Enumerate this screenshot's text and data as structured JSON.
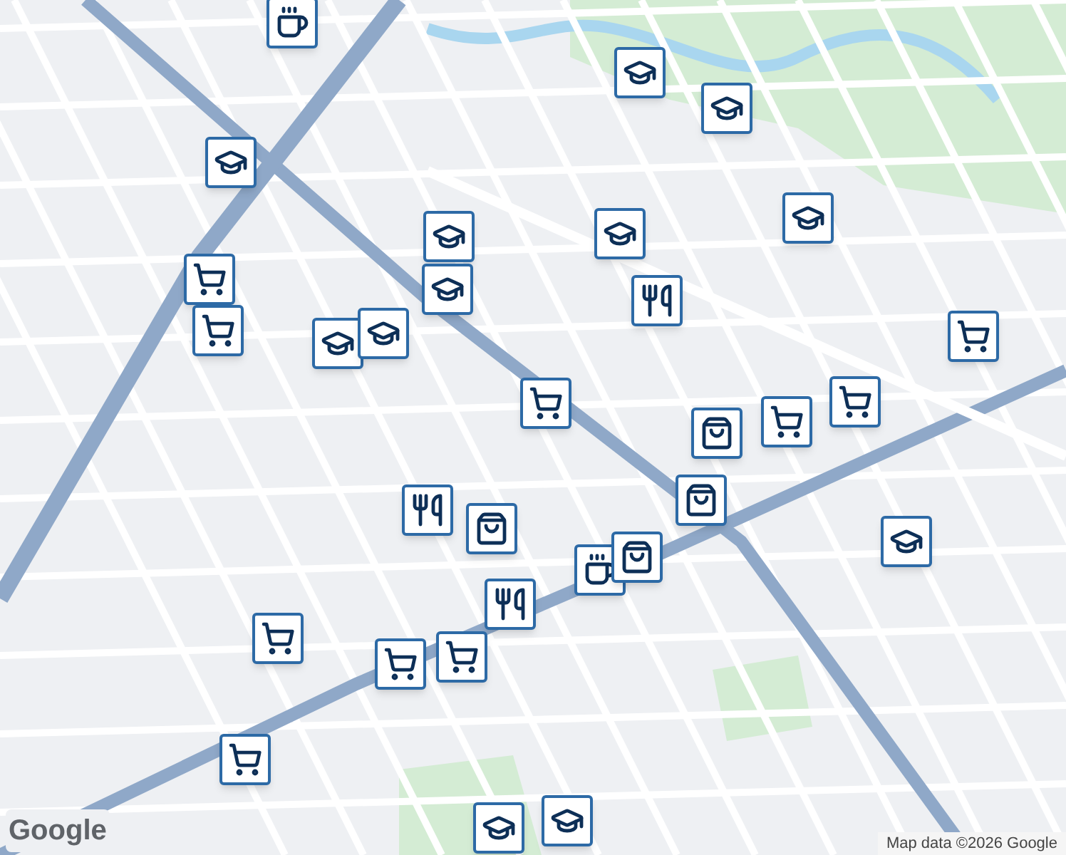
{
  "map": {
    "markers": [
      {
        "kind": "coffee"
      },
      {
        "kind": "school"
      },
      {
        "kind": "grocery"
      },
      {
        "kind": "grocery"
      },
      {
        "kind": "school"
      },
      {
        "kind": "school"
      },
      {
        "kind": "school"
      },
      {
        "kind": "school"
      },
      {
        "kind": "grocery"
      },
      {
        "kind": "school"
      },
      {
        "kind": "restaurant"
      },
      {
        "kind": "school"
      },
      {
        "kind": "school"
      },
      {
        "kind": "school"
      },
      {
        "kind": "grocery"
      },
      {
        "kind": "grocery"
      },
      {
        "kind": "grocery"
      },
      {
        "kind": "shopping"
      },
      {
        "kind": "shopping"
      },
      {
        "kind": "restaurant"
      },
      {
        "kind": "shopping"
      },
      {
        "kind": "coffee"
      },
      {
        "kind": "shopping"
      },
      {
        "kind": "restaurant"
      },
      {
        "kind": "grocery"
      },
      {
        "kind": "grocery"
      },
      {
        "kind": "grocery"
      },
      {
        "kind": "grocery"
      },
      {
        "kind": "school"
      },
      {
        "kind": "school"
      },
      {
        "kind": "school"
      }
    ]
  },
  "logo": "Google",
  "attribution": "Map data ©2026 Google"
}
